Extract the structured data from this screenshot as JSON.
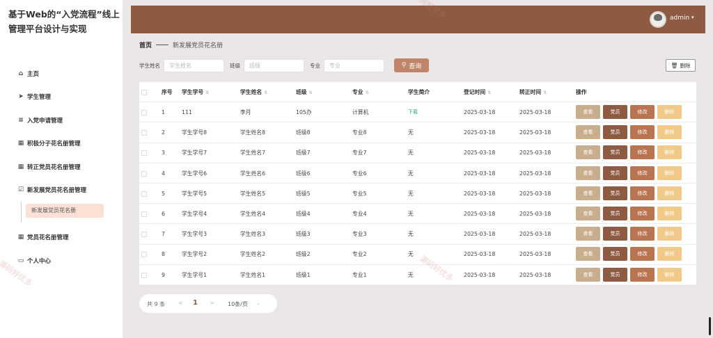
{
  "app": {
    "title": "基于Web的“入党流程”线上管理平台设计与实现"
  },
  "sidebar": {
    "items": [
      {
        "label": "主页",
        "icon": "home-icon",
        "glyph": "⌂"
      },
      {
        "label": "学生管理",
        "icon": "send-icon",
        "glyph": "➤"
      },
      {
        "label": "入党申请管理",
        "icon": "list-icon",
        "glyph": "≡"
      },
      {
        "label": "积极分子花名册管理",
        "icon": "grid-icon",
        "glyph": "▦"
      },
      {
        "label": "转正党员花名册管理",
        "icon": "grid-icon",
        "glyph": "▦"
      },
      {
        "label": "新发展党员花名册管理",
        "icon": "checkbox-icon",
        "glyph": "☑"
      }
    ],
    "submenu_active": "新发展党员花名册",
    "lower_items": [
      {
        "label": "党员花名册管理",
        "icon": "grid-icon",
        "glyph": "▦"
      },
      {
        "label": "个人中心",
        "icon": "card-icon",
        "glyph": "▭"
      }
    ]
  },
  "header": {
    "username": "admin",
    "caret": "▾"
  },
  "breadcrumb": {
    "home": "首页",
    "current": "新发展党员花名册"
  },
  "search": {
    "name_label": "学生姓名",
    "name_placeholder": "学生姓名",
    "class_label": "班级",
    "class_placeholder": "班级",
    "major_label": "专业",
    "major_placeholder": "专业",
    "button": "查询",
    "delete_button": "删除"
  },
  "table": {
    "columns": [
      "序号",
      "学生学号",
      "学生姓名",
      "班级",
      "专业",
      "学生简介",
      "登记时间",
      "转正时间",
      "操作"
    ],
    "rows": [
      [
        "1",
        "111",
        "李月",
        "105办",
        "计算机",
        "下载",
        "2025-03-18",
        "2025-03-18"
      ],
      [
        "2",
        "学生学号8",
        "学生姓名8",
        "班级8",
        "专业8",
        "无",
        "2025-03-18",
        "2025-03-18"
      ],
      [
        "3",
        "学生学号7",
        "学生姓名7",
        "班级7",
        "专业7",
        "无",
        "2025-03-18",
        "2025-03-18"
      ],
      [
        "4",
        "学生学号6",
        "学生姓名6",
        "班级6",
        "专业6",
        "无",
        "2025-03-18",
        "2025-03-18"
      ],
      [
        "5",
        "学生学号5",
        "学生姓名5",
        "班级5",
        "专业5",
        "无",
        "2025-03-18",
        "2025-03-18"
      ],
      [
        "6",
        "学生学号4",
        "学生姓名4",
        "班级4",
        "专业4",
        "无",
        "2025-03-18",
        "2025-03-18"
      ],
      [
        "7",
        "学生学号3",
        "学生姓名3",
        "班级3",
        "专业3",
        "无",
        "2025-03-18",
        "2025-03-18"
      ],
      [
        "8",
        "学生学号2",
        "学生姓名2",
        "班级2",
        "专业2",
        "无",
        "2025-03-18",
        "2025-03-18"
      ],
      [
        "9",
        "学生学号1",
        "学生姓名1",
        "班级1",
        "专业1",
        "无",
        "2025-03-18",
        "2025-03-18"
      ]
    ],
    "actions": [
      "查看",
      "党员",
      "修改",
      "删除"
    ]
  },
  "pagination": {
    "total": "共 9 条",
    "current_page": "1",
    "page_size": "10条/页",
    "prev": "<",
    "next": ">",
    "caret": "⌄"
  },
  "watermark": {
    "text": "源码好优多"
  },
  "colors": {
    "topbar": "#8c5b42",
    "view": "#c8ae8c",
    "member": "#8c5b42",
    "edit": "#b97551",
    "delete": "#f1c988",
    "search": "#c08468"
  }
}
